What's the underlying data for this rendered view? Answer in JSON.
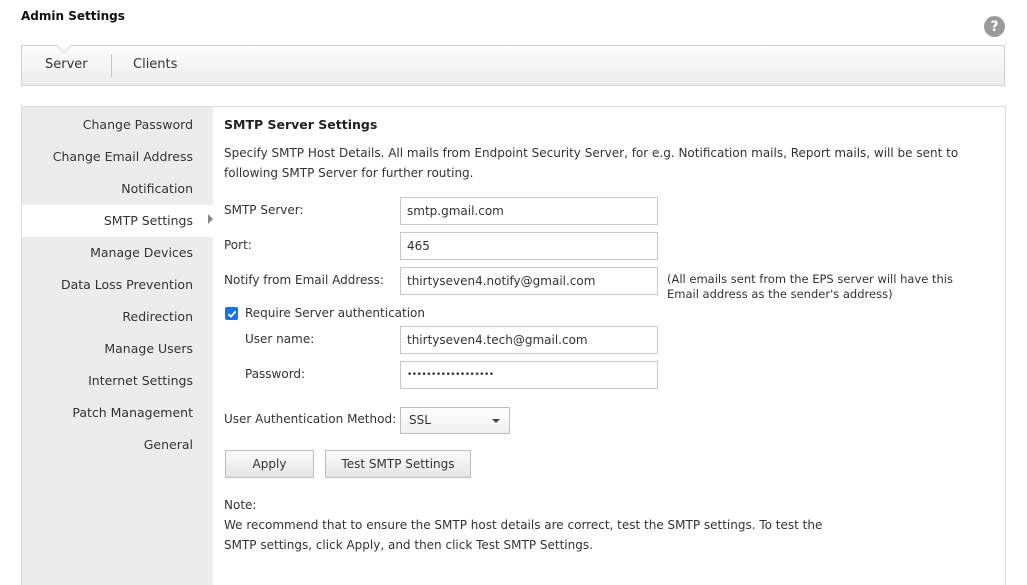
{
  "header": {
    "title": "Admin Settings",
    "help_glyph": "?"
  },
  "tabs": [
    {
      "label": "Server",
      "active": true
    },
    {
      "label": "Clients",
      "active": false
    }
  ],
  "sidebar": {
    "items": [
      {
        "label": "Change Password"
      },
      {
        "label": "Change Email Address"
      },
      {
        "label": "Notification"
      },
      {
        "label": "SMTP Settings",
        "active": true
      },
      {
        "label": "Manage Devices"
      },
      {
        "label": "Data Loss Prevention"
      },
      {
        "label": "Redirection"
      },
      {
        "label": "Manage Users"
      },
      {
        "label": "Internet Settings"
      },
      {
        "label": "Patch Management"
      },
      {
        "label": "General"
      }
    ]
  },
  "smtp": {
    "title": "SMTP Server Settings",
    "description": "Specify SMTP Host Details. All mails from Endpoint Security Server, for e.g. Notification mails, Report mails, will be sent to following SMTP Server for further routing.",
    "server_label": "SMTP Server:",
    "server_value": "smtp.gmail.com",
    "port_label": "Port:",
    "port_value": "465",
    "notify_label": "Notify from Email Address:",
    "notify_value": "thirtyseven4.notify@gmail.com",
    "notify_hint": "(All emails sent from the EPS server will have this Email address as the sender's address)",
    "require_auth_label": "Require Server authentication",
    "require_auth_checked": true,
    "username_label": "User name:",
    "username_value": "thirtyseven4.tech@gmail.com",
    "password_label": "Password:",
    "password_value": "••••••••••••••••••",
    "auth_method_label": "User Authentication Method:",
    "auth_method_value": "SSL",
    "apply_label": "Apply",
    "test_label": "Test SMTP Settings",
    "note_title": "Note:",
    "note_text": "We recommend that to ensure the SMTP host details are correct, test the SMTP settings. To test the SMTP settings, click Apply, and then click Test SMTP Settings."
  },
  "colors": {
    "accent": "#1a73e8",
    "sidebar_bg": "#ececec",
    "help_bg": "#9a9a9a"
  },
  "icons": {
    "help": "help-icon",
    "checkbox": "checkmark-icon",
    "nav_arrow": "caret-right-icon",
    "select_caret": "chevron-down-icon"
  }
}
